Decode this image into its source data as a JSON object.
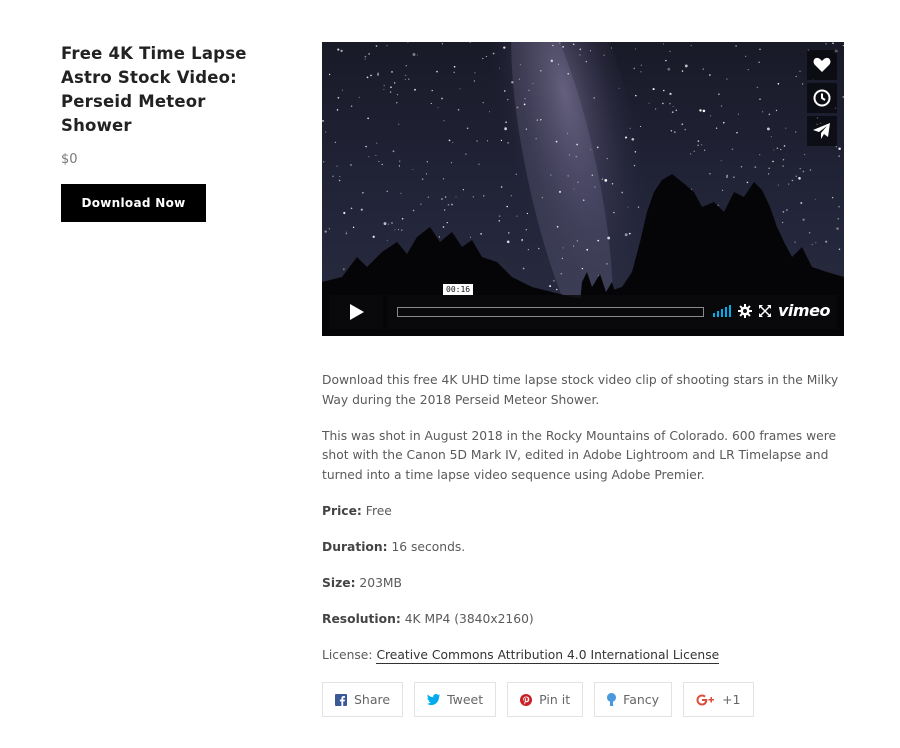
{
  "product": {
    "title": "Free 4K Time Lapse Astro Stock Video: Perseid Meteor Shower",
    "price": "$0",
    "download_label": "Download Now"
  },
  "video": {
    "current_time": "00:16",
    "progress": 0.07,
    "brand": "vimeo",
    "side_icons": [
      "heart-icon",
      "clock-icon",
      "paper-plane-icon"
    ]
  },
  "description": {
    "para1": "Download this free 4K UHD time lapse stock video clip of shooting stars in the Milky Way during the 2018 Perseid Meteor Shower.",
    "para2": "This was shot in August 2018 in the Rocky Mountains of Colorado. 600 frames were shot with the Canon 5D Mark IV, edited in Adobe Lightroom and LR Timelapse and turned into a time lapse video sequence using Adobe Premier.",
    "price_label": "Price:",
    "price_value": "Free",
    "duration_label": "Duration:",
    "duration_value": "16 seconds.",
    "size_label": "Size:",
    "size_value": "203MB",
    "resolution_label": "Resolution:",
    "resolution_value": "4K MP4 (3840x2160)",
    "license_label": "License:",
    "license_link": "Creative Commons Attribution 4.0 International License"
  },
  "share": {
    "facebook": "Share",
    "twitter": "Tweet",
    "pinterest": "Pin it",
    "fancy": "Fancy",
    "google": "+1",
    "colors": {
      "facebook": "#3b5998",
      "twitter": "#00aced",
      "pinterest": "#cb2027",
      "fancy": "#4999dc",
      "google": "#dd4b39"
    }
  }
}
